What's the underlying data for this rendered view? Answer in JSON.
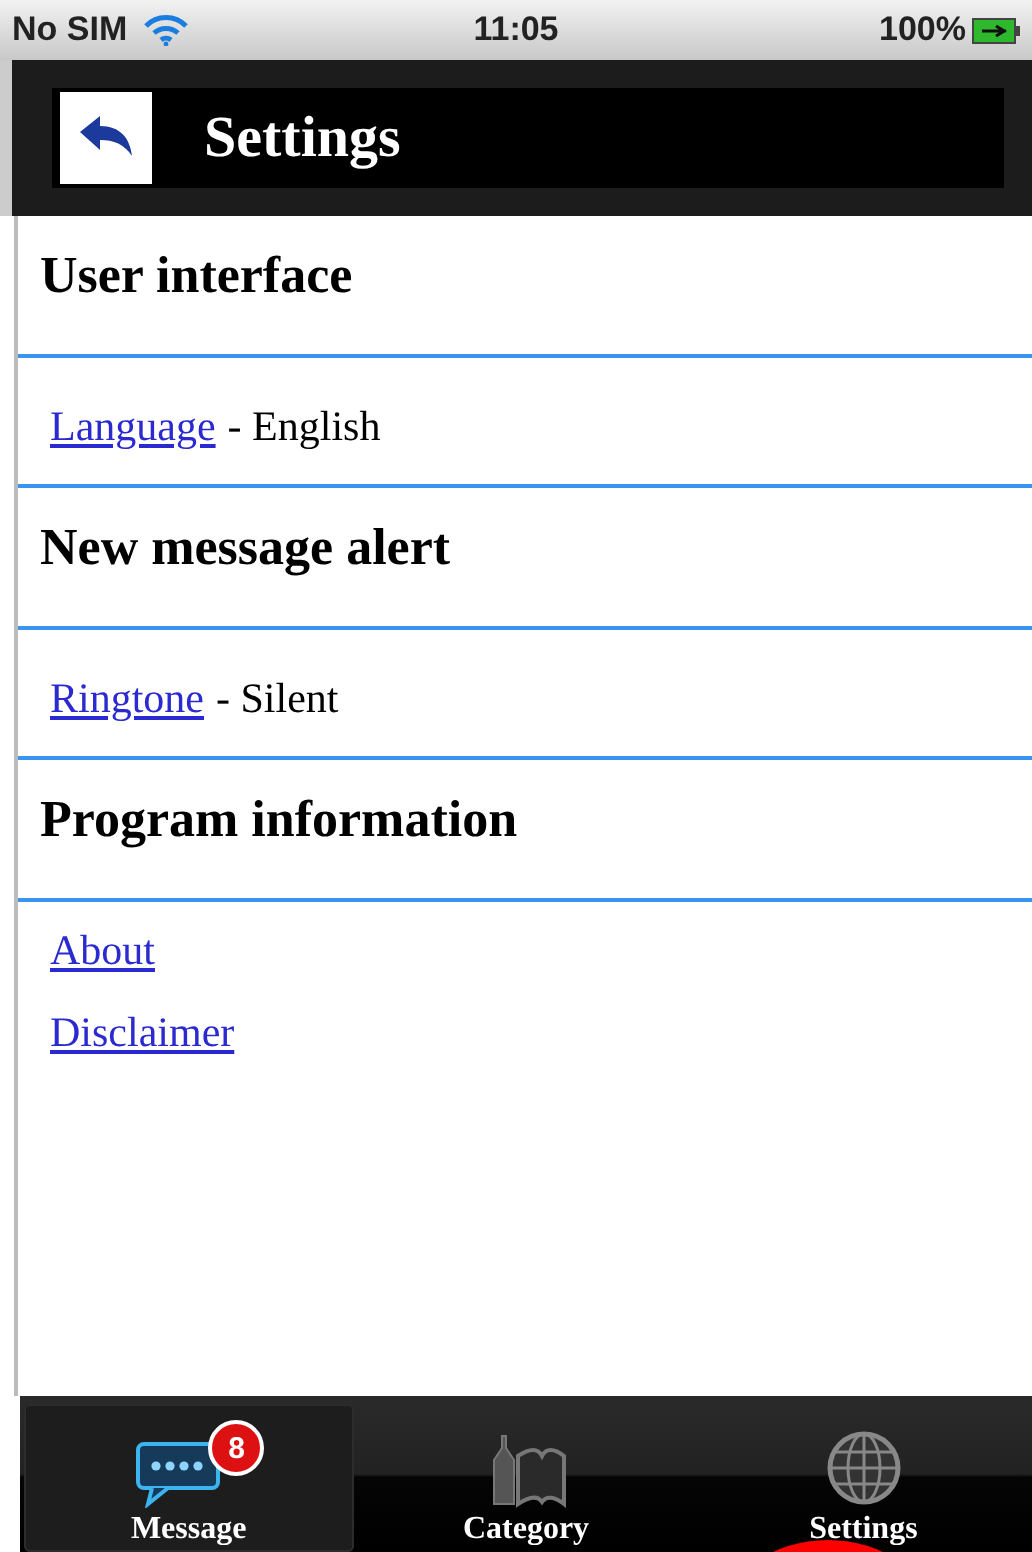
{
  "status_bar": {
    "carrier": "No SIM",
    "time": "11:05",
    "battery": "100%"
  },
  "header": {
    "title": "Settings"
  },
  "sections": [
    {
      "heading": "User interface",
      "items": [
        {
          "link": "Language",
          "value": "- English"
        }
      ]
    },
    {
      "heading": "New message alert",
      "items": [
        {
          "link": "Ringtone",
          "value": "- Silent"
        }
      ]
    },
    {
      "heading": "Program information",
      "items": [
        {
          "link": "About"
        },
        {
          "link": "Disclaimer"
        }
      ]
    }
  ],
  "tab_bar": [
    {
      "label": "Message",
      "badge": "8",
      "selected": true
    },
    {
      "label": "Category",
      "selected": false
    },
    {
      "label": "Settings",
      "selected": false
    }
  ]
}
